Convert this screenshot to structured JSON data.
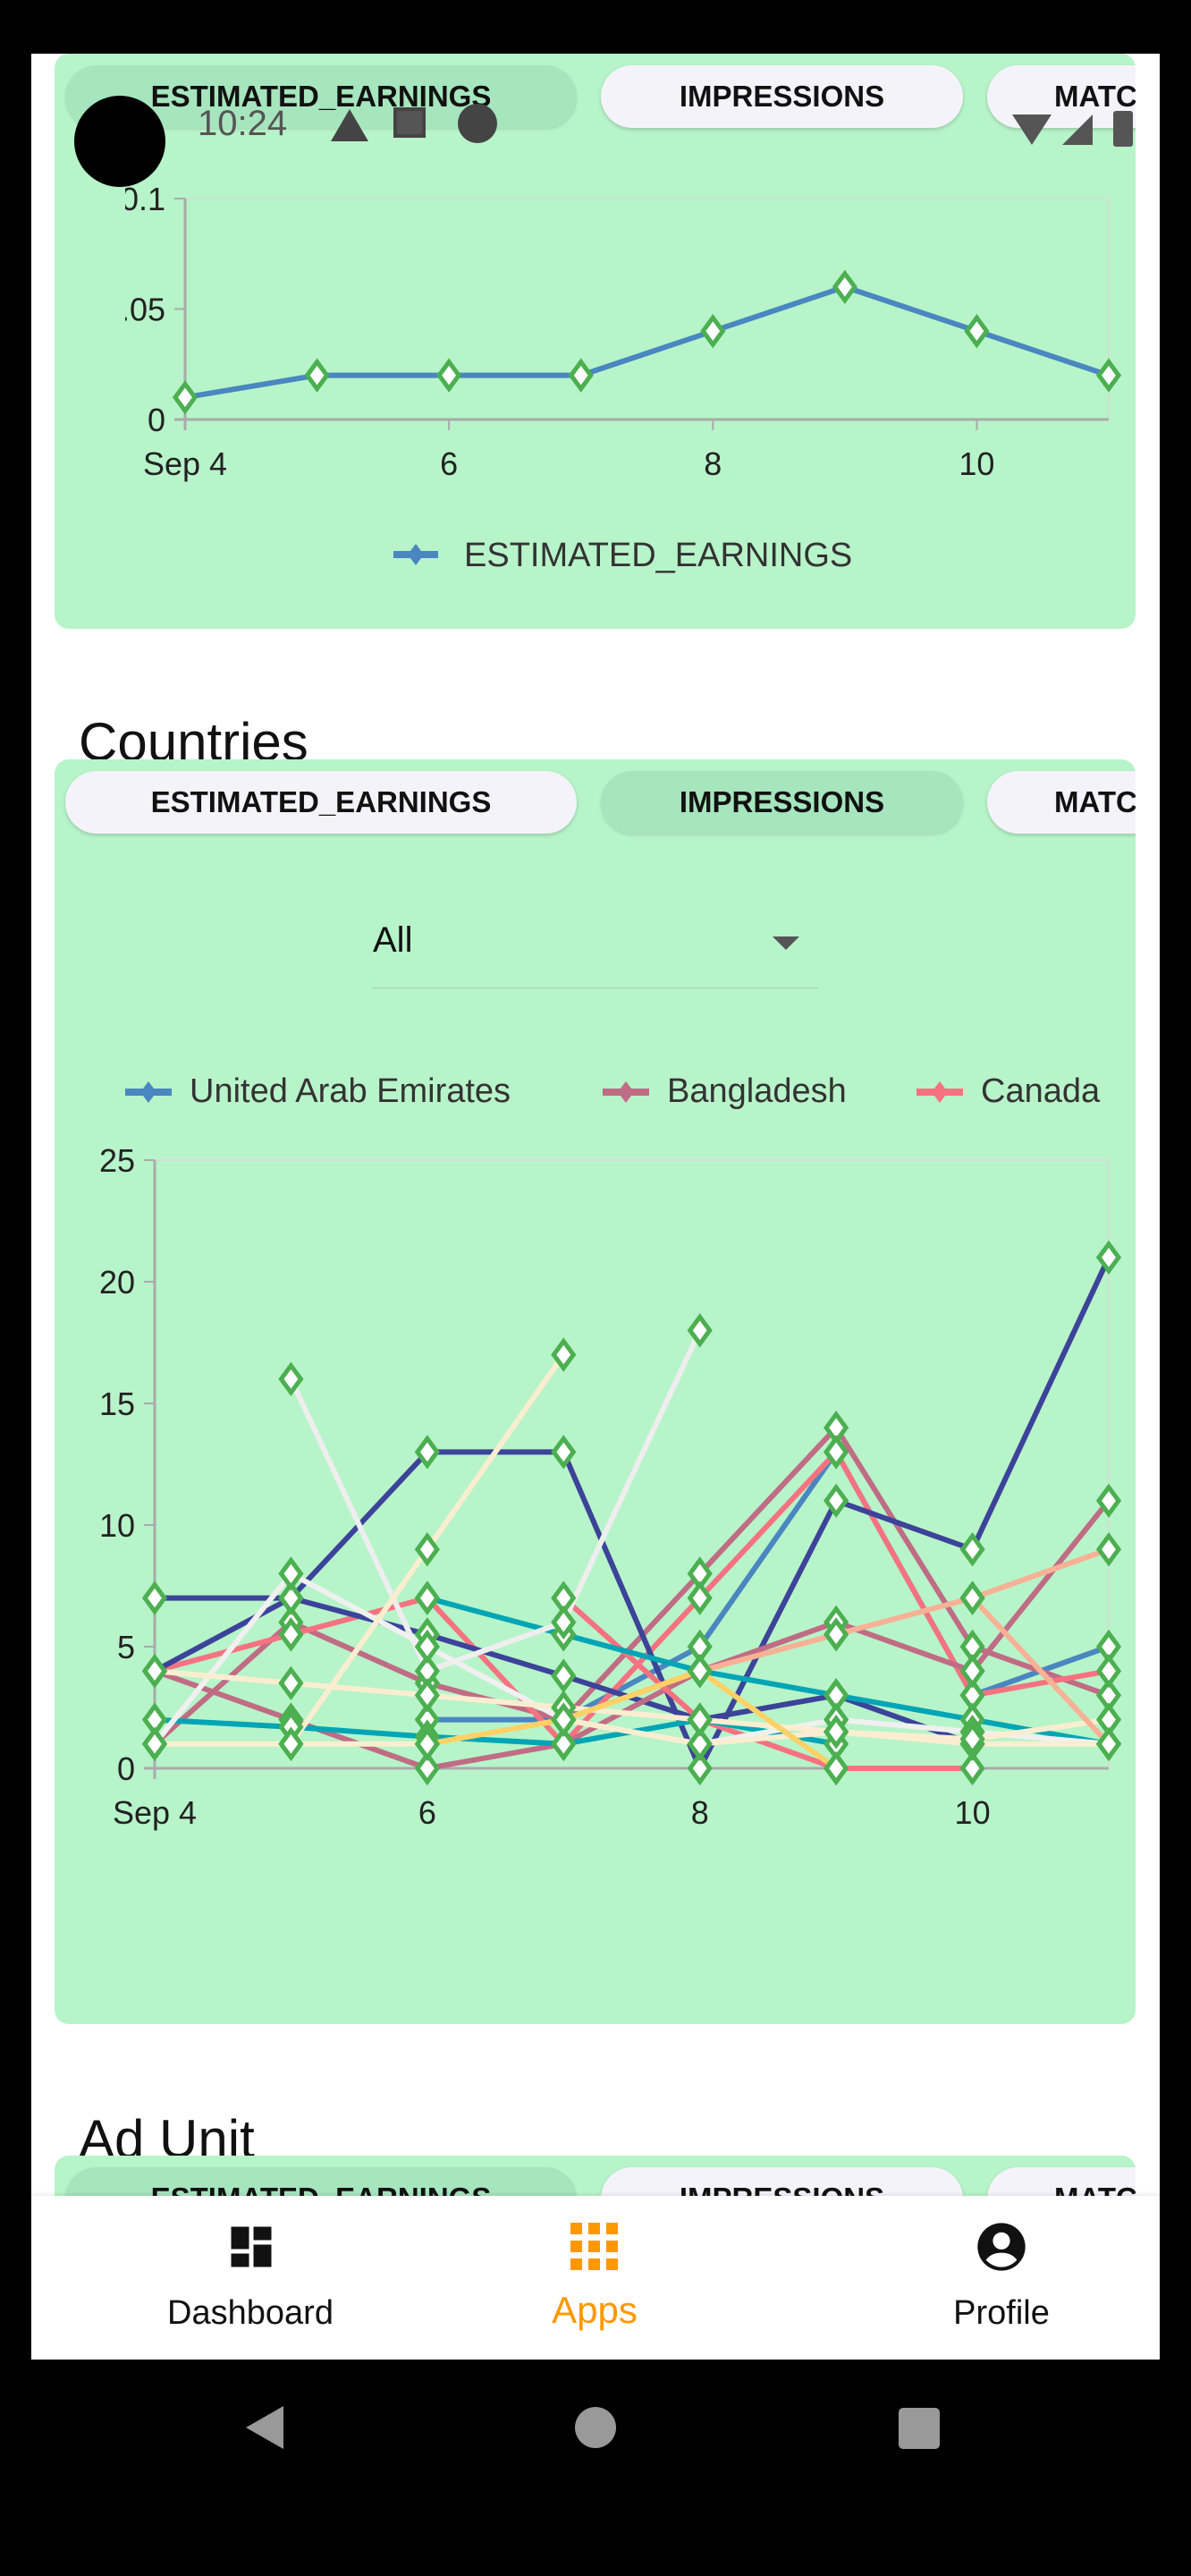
{
  "status_bar": {
    "time": "10:24",
    "icons": [
      "alert-icon",
      "gmail-icon",
      "app-icon",
      "wifi-icon",
      "signal-icon",
      "battery-icon"
    ]
  },
  "metric_tabs": [
    "ESTIMATED_EARNINGS",
    "IMPRESSIONS",
    "MATC"
  ],
  "sections": {
    "countries": "Countries",
    "ad_unit": "Ad Unit"
  },
  "countries_filter": {
    "selected": "All"
  },
  "chart_data": [
    {
      "type": "line",
      "title": "",
      "x": [
        "Sep 4",
        "Sep 5",
        "Sep 6",
        "Sep 7",
        "Sep 8",
        "Sep 9",
        "Sep 10",
        "Sep 11"
      ],
      "x_tick_labels": [
        "Sep 4",
        "6",
        "8",
        "10"
      ],
      "y_tick_labels": [
        "0",
        "0.05",
        "0.1"
      ],
      "ylim": [
        0,
        0.1
      ],
      "grid": false,
      "legend": "bottom",
      "series": [
        {
          "name": "ESTIMATED_EARNINGS",
          "color": "#4a86c0",
          "values": [
            0.01,
            0.02,
            0.02,
            0.02,
            0.04,
            0.06,
            0.04,
            0.02
          ]
        }
      ]
    },
    {
      "type": "line",
      "title": "",
      "x": [
        "Sep 4",
        "Sep 5",
        "Sep 6",
        "Sep 7",
        "Sep 8",
        "Sep 9",
        "Sep 10",
        "Sep 11"
      ],
      "x_tick_labels": [
        "Sep 4",
        "6",
        "8",
        "10"
      ],
      "y_tick_labels": [
        "0",
        "5",
        "10",
        "15",
        "20",
        "25"
      ],
      "ylim": [
        0,
        25
      ],
      "grid": false,
      "legend": "top",
      "marker_color": "#4caf50",
      "series": [
        {
          "name": "United Arab Emirates",
          "color": "#4a86c0",
          "values": [
            null,
            null,
            2,
            2,
            5,
            13,
            3,
            5
          ]
        },
        {
          "name": "Bangladesh",
          "color": "#c06c84",
          "values": [
            1,
            6,
            3.5,
            2,
            8,
            14,
            5,
            3
          ]
        },
        {
          "name": "Canada",
          "color": "#f67280",
          "values": [
            4,
            5.5,
            7,
            1,
            7,
            13,
            3,
            4
          ]
        },
        {
          "color": "#3c4399",
          "values": [
            7,
            7,
            13,
            13,
            0,
            11,
            9,
            21
          ]
        },
        {
          "color": "#3c4399",
          "values": [
            4,
            7,
            5.5,
            3.8,
            2,
            3,
            1,
            null
          ]
        },
        {
          "color": "#c06c84",
          "values": [
            4,
            2,
            0,
            1,
            4,
            6,
            4,
            11
          ]
        },
        {
          "color": "#f67280",
          "values": [
            null,
            null,
            null,
            7,
            2,
            0,
            0,
            null
          ]
        },
        {
          "color": "#00a5b5",
          "values": [
            2,
            1.7,
            1.3,
            1,
            2,
            1,
            null,
            null
          ]
        },
        {
          "color": "#00a5b5",
          "values": [
            null,
            null,
            7,
            5.5,
            4,
            3,
            2,
            1
          ]
        },
        {
          "color": "#eeeeee",
          "values": [
            null,
            16,
            4,
            6,
            18,
            null,
            null,
            null
          ]
        },
        {
          "color": "#f0f0f0",
          "values": [
            1,
            8,
            5,
            2,
            1,
            2,
            1.5,
            1
          ]
        },
        {
          "color": "#fbeed0",
          "values": [
            1,
            1,
            1,
            2,
            1,
            1.5,
            1,
            1
          ]
        },
        {
          "color": "#fbeed0",
          "values": [
            4,
            3.5,
            3,
            2.5,
            2,
            1.5,
            1.2,
            2
          ]
        },
        {
          "color": "#fbeed0",
          "values": [
            null,
            1,
            9,
            17,
            null,
            null,
            null,
            null
          ]
        },
        {
          "color": "#f8b195",
          "values": [
            null,
            null,
            null,
            2,
            4,
            5.5,
            7,
            9
          ]
        },
        {
          "color": "#f8b195",
          "values": [
            null,
            null,
            null,
            null,
            null,
            null,
            7,
            1
          ]
        },
        {
          "color": "#ffd166",
          "values": [
            null,
            null,
            1,
            2,
            4,
            0,
            null,
            null
          ]
        }
      ]
    }
  ],
  "bottom_nav": [
    {
      "label": "Dashboard",
      "icon": "dashboard-icon",
      "active": false
    },
    {
      "label": "Apps",
      "icon": "apps-grid-icon",
      "active": true
    },
    {
      "label": "Profile",
      "icon": "profile-icon",
      "active": false
    }
  ],
  "colors": {
    "card_bg": "#b7f4c9",
    "accent": "#ff9800",
    "marker": "#4caf50"
  }
}
